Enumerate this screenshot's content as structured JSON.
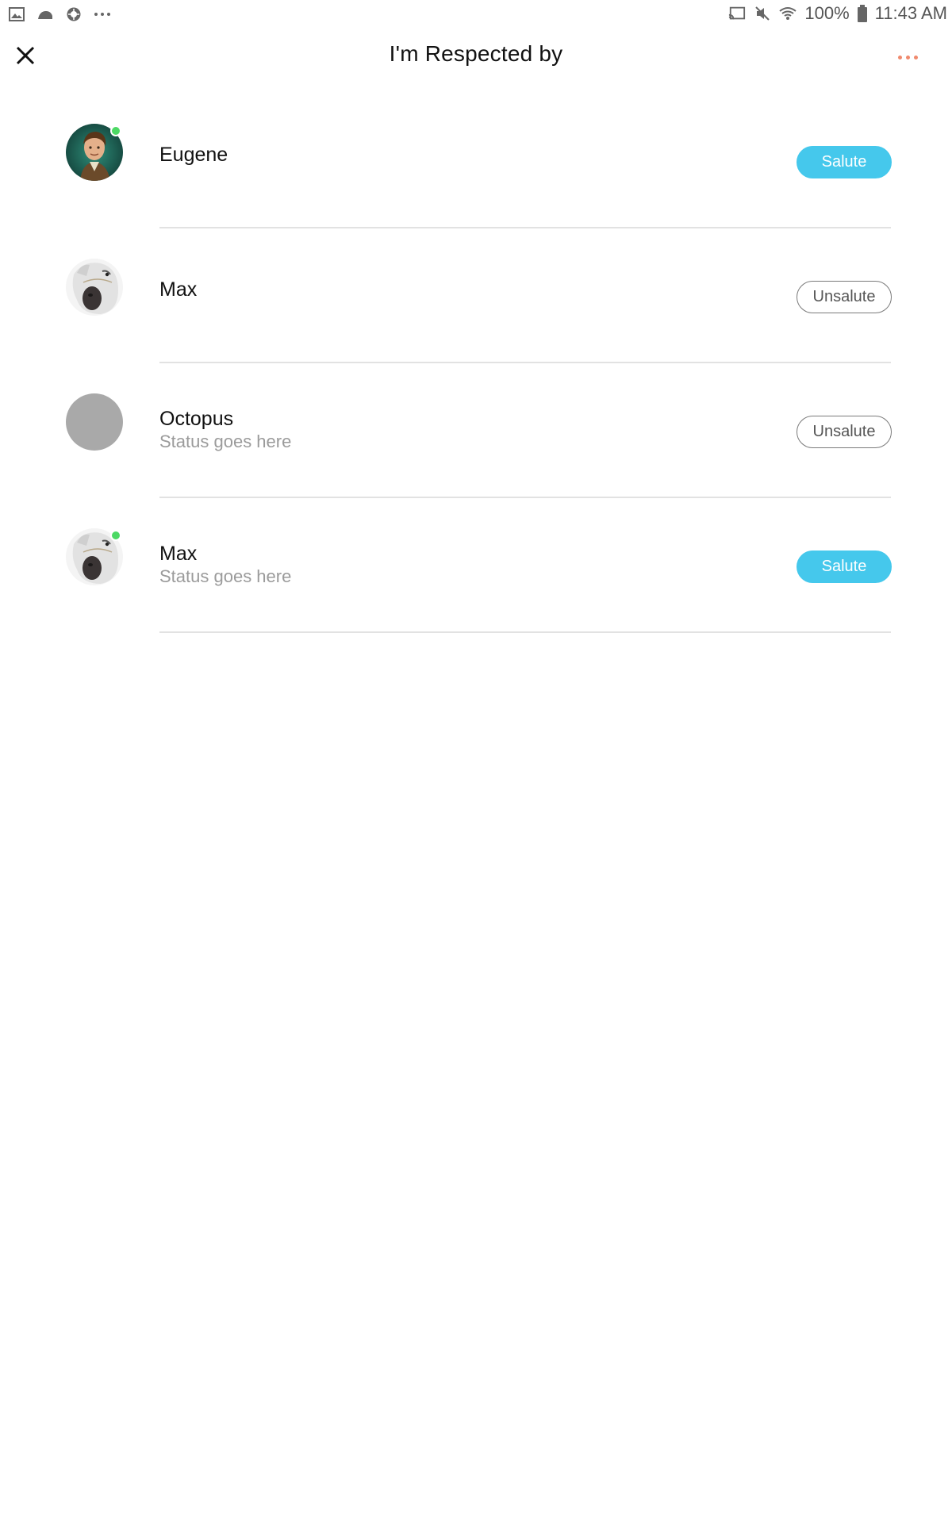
{
  "status_bar": {
    "battery": "100%",
    "time": "11:43 AM",
    "left_icons": [
      "gallery-icon",
      "weather-icon",
      "app-icon",
      "more-notifications-icon"
    ],
    "right_icons": [
      "cast-icon",
      "mute-icon",
      "wifi-icon",
      "battery-icon"
    ]
  },
  "header": {
    "title": "I'm Respected by",
    "close_icon": "close-icon",
    "more_icon": "more-icon",
    "more_color": "#f08a6e"
  },
  "colors": {
    "salute": "#45c8ec",
    "online": "#4cd964"
  },
  "people": [
    {
      "name": "Eugene",
      "status": "",
      "button": "Salute",
      "button_type": "salute",
      "online": true,
      "avatar": "eugene-avatar"
    },
    {
      "name": "Max",
      "status": "",
      "button": "Unsalute",
      "button_type": "unsalute",
      "online": false,
      "avatar": "horse-avatar"
    },
    {
      "name": "Octopus",
      "status": "Status goes here",
      "button": "Unsalute",
      "button_type": "unsalute",
      "online": false,
      "avatar": "placeholder-avatar"
    },
    {
      "name": "Max",
      "status": "Status goes here",
      "button": "Salute",
      "button_type": "salute",
      "online": true,
      "avatar": "horse-avatar"
    }
  ]
}
